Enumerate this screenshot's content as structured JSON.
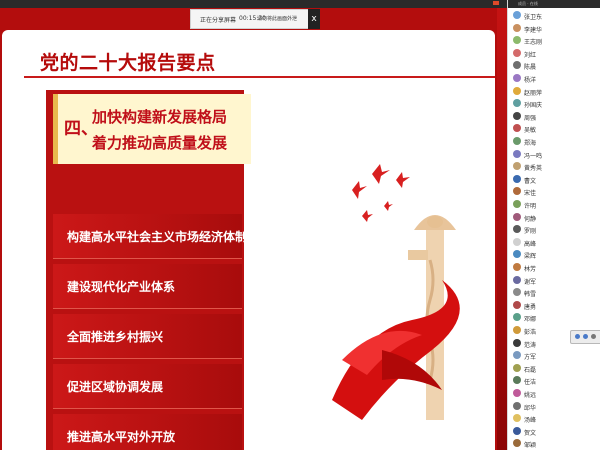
{
  "notice": {
    "left": "正在分享屏幕",
    "mid": "00:15:30",
    "right": "请勿将此画面外泄",
    "close": "x"
  },
  "slide": {
    "title": "党的二十大报告要点",
    "section": {
      "number": "四、",
      "line1": "加快构建新发展格局",
      "line2": "着力推动高质量发展"
    },
    "items": [
      "构建高水平社会主义市场经济体制",
      "建设现代化产业体系",
      "全面推进乡村振兴",
      "促进区域协调发展",
      "推进高水平对外开放"
    ]
  },
  "members": {
    "header": "成员 · 在线",
    "rows": [
      {
        "name": "张卫东",
        "state": "",
        "color": "#6aa0d8"
      },
      {
        "name": "李建华",
        "state": "",
        "color": "#c99060"
      },
      {
        "name": "王志刚",
        "state": "",
        "color": "#8cba6c"
      },
      {
        "name": "刘红",
        "state": "",
        "color": "#d46a6a"
      },
      {
        "name": "陈晨",
        "state": "",
        "color": "#6f6f6f"
      },
      {
        "name": "杨洋",
        "state": "",
        "color": "#9a78c4"
      },
      {
        "name": "赵丽萍",
        "state": "",
        "color": "#e0aa3a"
      },
      {
        "name": "孙国庆",
        "state": "",
        "color": "#5f9fa0"
      },
      {
        "name": "周强",
        "state": "",
        "color": "#444444"
      },
      {
        "name": "吴敏",
        "state": "",
        "color": "#c05050"
      },
      {
        "name": "郑海",
        "state": "",
        "color": "#6a9a6a"
      },
      {
        "name": "冯一鸣",
        "state": "",
        "color": "#7a7ac0"
      },
      {
        "name": "黄秀英",
        "state": "",
        "color": "#c0a070"
      },
      {
        "name": "曹文",
        "state": "",
        "color": "#3a6ab0"
      },
      {
        "name": "宋佳",
        "state": "",
        "color": "#b06a3a"
      },
      {
        "name": "许明",
        "state": "",
        "color": "#7aa05a"
      },
      {
        "name": "何静",
        "state": "",
        "color": "#a05a7a"
      },
      {
        "name": "罗刚",
        "state": "",
        "color": "#5a5a5a"
      },
      {
        "name": "高峰",
        "state": "",
        "color": "#d0d0d0"
      },
      {
        "name": "梁辉",
        "state": "",
        "color": "#4a8ac0"
      },
      {
        "name": "林芳",
        "state": "",
        "color": "#c07a40"
      },
      {
        "name": "谢军",
        "state": "",
        "color": "#6a6aa0"
      },
      {
        "name": "韩雪",
        "state": "",
        "color": "#8a8a8a"
      },
      {
        "name": "唐勇",
        "state": "",
        "color": "#b04a4a"
      },
      {
        "name": "邓娜",
        "state": "",
        "color": "#5aa08a"
      },
      {
        "name": "彭浩",
        "state": "",
        "color": "#d09a3a"
      },
      {
        "name": "范涛",
        "state": "",
        "color": "#3a3a3a"
      },
      {
        "name": "方军",
        "state": "",
        "color": "#7a9ac0"
      },
      {
        "name": "石磊",
        "state": "",
        "color": "#a0a050"
      },
      {
        "name": "任洁",
        "state": "",
        "color": "#5a7a5a"
      },
      {
        "name": "姚远",
        "state": "",
        "color": "#c05a9a"
      },
      {
        "name": "邱华",
        "state": "",
        "color": "#707070"
      },
      {
        "name": "汤峰",
        "state": "",
        "color": "#e0c060"
      },
      {
        "name": "贺文",
        "state": "",
        "color": "#3a5a9a"
      },
      {
        "name": "邹颖",
        "state": "",
        "color": "#9a6a3a"
      }
    ]
  }
}
